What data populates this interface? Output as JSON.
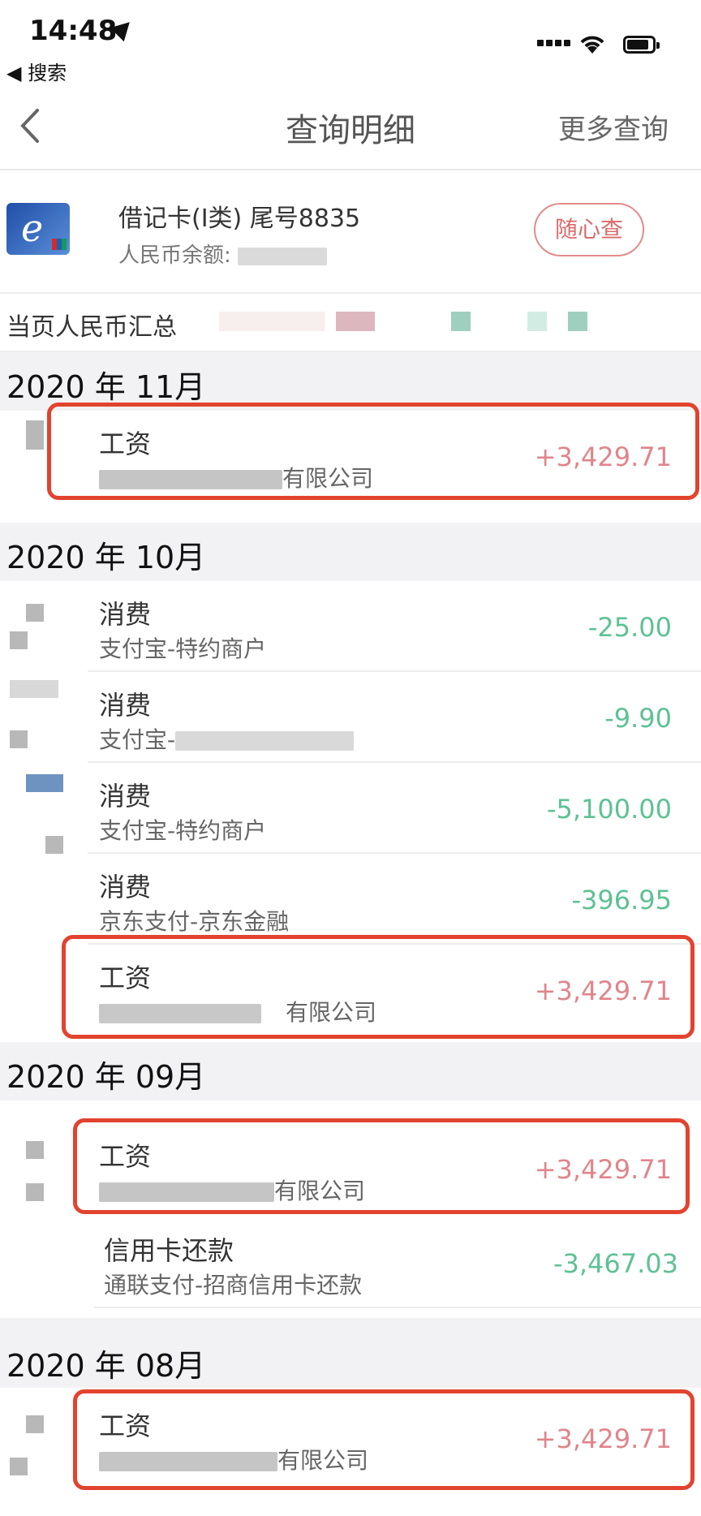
{
  "status_bar": {
    "time": "14:48",
    "back_app": "◀ 搜索"
  },
  "nav": {
    "title": "查询明细",
    "more": "更多查询"
  },
  "card": {
    "name": "借记卡(Ⅰ类) 尾号8835",
    "balance_label": "人民币余额:",
    "button": "随心查"
  },
  "summary": {
    "label": "当页人民币汇总"
  },
  "months": [
    {
      "label": "2020 年 11月"
    },
    {
      "label": "2020 年 10月"
    },
    {
      "label": "2020 年 09月"
    },
    {
      "label": "2020 年 08月"
    }
  ],
  "transactions": [
    {
      "type": "工资",
      "desc": "有限公司",
      "amount": "+3,429.71"
    },
    {
      "type": "消费",
      "desc": "支付宝-特约商户",
      "amount": "-25.00"
    },
    {
      "type": "消费",
      "desc": "支付宝-",
      "amount": "-9.90"
    },
    {
      "type": "消费",
      "desc": "支付宝-特约商户",
      "amount": "-5,100.00"
    },
    {
      "type": "消费",
      "desc": "京东支付-京东金融",
      "amount": "-396.95"
    },
    {
      "type": "工资",
      "desc": "有限公司",
      "amount": "+3,429.71"
    },
    {
      "type": "工资",
      "desc": "有限公司",
      "amount": "+3,429.71"
    },
    {
      "type": "信用卡还款",
      "desc": "通联支付-招商信用卡还款",
      "amount": "-3,467.03"
    },
    {
      "type": "工资",
      "desc": "有限公司",
      "amount": "+3,429.71"
    }
  ],
  "colors": {
    "positive": "#e0858b",
    "negative": "#5ec194",
    "highlight": "#e2432f"
  }
}
